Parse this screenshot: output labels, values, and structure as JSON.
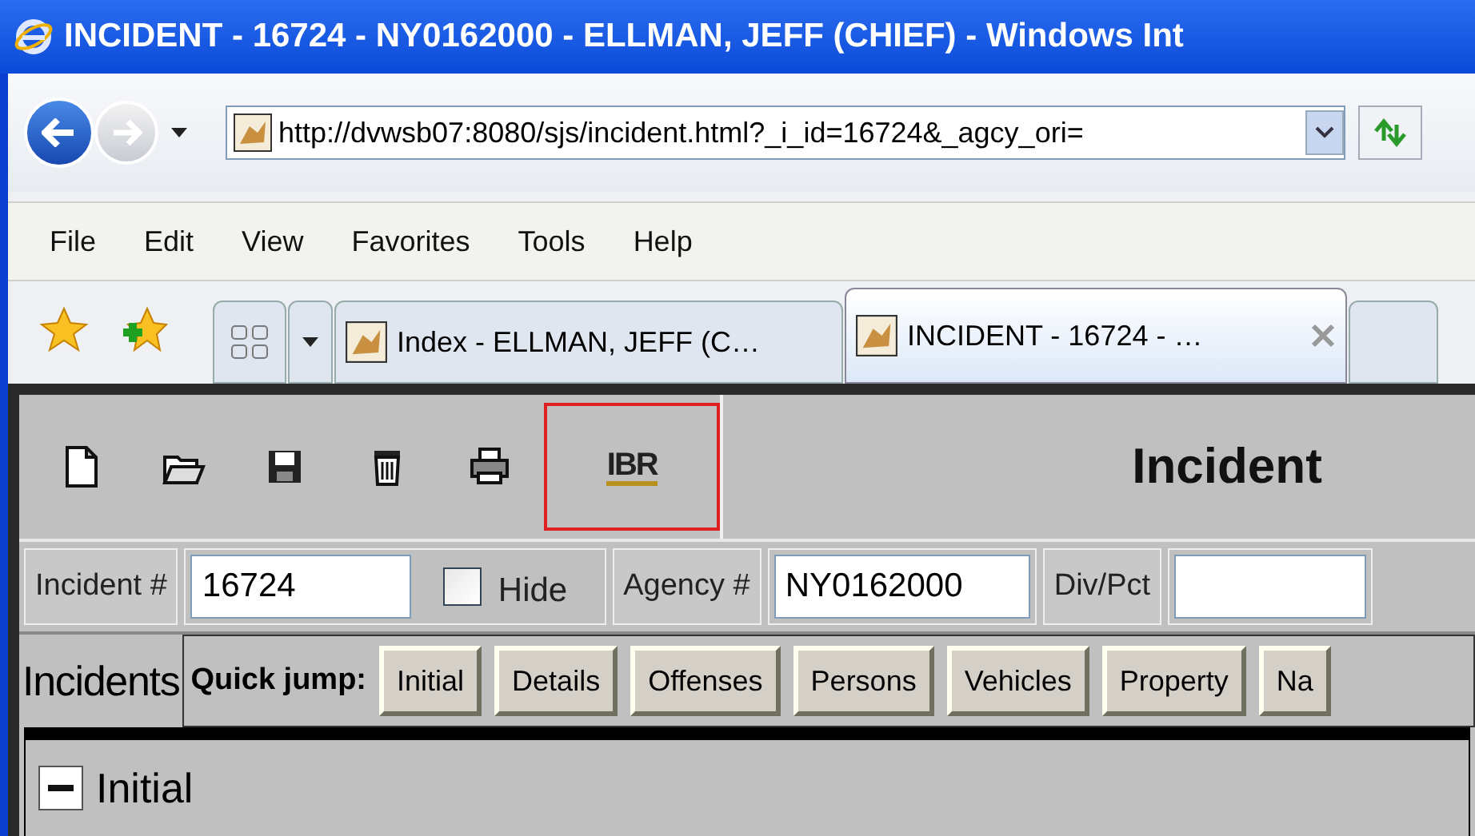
{
  "window": {
    "title": "INCIDENT - 16724 - NY0162000 - ELLMAN, JEFF (CHIEF) - Windows Int"
  },
  "address_bar": {
    "value": "http://dvwsb07:8080/sjs/incident.html?_i_id=16724&_agcy_ori="
  },
  "menu": [
    "File",
    "Edit",
    "View",
    "Favorites",
    "Tools",
    "Help"
  ],
  "tabs": [
    {
      "label": "Index - ELLMAN, JEFF (C…",
      "selected": false
    },
    {
      "label": "INCIDENT - 16724 - …",
      "selected": true
    }
  ],
  "toolbar": [
    {
      "kind": "new",
      "highlighted": false
    },
    {
      "kind": "open",
      "highlighted": false
    },
    {
      "kind": "save",
      "highlighted": false
    },
    {
      "kind": "delete",
      "highlighted": false
    },
    {
      "kind": "print",
      "highlighted": false
    },
    {
      "kind": "ibr",
      "label": "IBR",
      "highlighted": true
    }
  ],
  "page_title": "Incident",
  "fields": [
    {
      "label": "Incident #",
      "value": "16724"
    },
    {
      "label": "Agency #",
      "value": "NY0162000"
    },
    {
      "label": "Div/Pct"
    }
  ],
  "hide": {
    "label": "Hide",
    "checked": false
  },
  "section_label": "Incidents",
  "quick_jump": {
    "label": "Quick jump:",
    "buttons": [
      "Initial",
      "Details",
      "Offenses",
      "Persons",
      "Vehicles",
      "Property",
      "Na"
    ]
  },
  "panel": {
    "title": "Initial",
    "expanded": true
  }
}
